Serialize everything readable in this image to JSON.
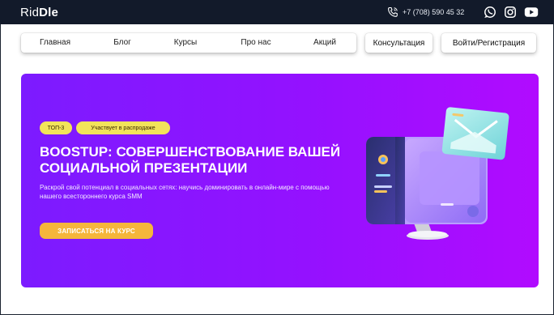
{
  "header": {
    "logo_light": "Rid",
    "logo_bold": "Dle",
    "phone": "+7 (708) 590 45 32",
    "icons": [
      "phone-icon",
      "whatsapp-icon",
      "instagram-icon",
      "youtube-icon"
    ]
  },
  "nav": {
    "items": [
      "Главная",
      "Блог",
      "Курсы",
      "Про нас",
      "Акций"
    ],
    "consult_label": "Консультация",
    "login_label": "Войти/Регистрация"
  },
  "hero": {
    "badge_top": "ТОП-3",
    "badge_sale": "Участвует в распродаже",
    "title": "BOOSTUP: СОВЕРШЕНСТВОВАНИЕ ВАШЕЙ СОЦИАЛЬНОЙ ПРЕЗЕНТАЦИИ",
    "description": "Раскрой свой потенциал в социальных сетях: научись доминировать в онлайн-мире с помощью нашего всестороннего курса SMM",
    "cta_label": "ЗАПИСАТЬСЯ НА КУРС",
    "illustration_icon": "computer-mail-illustration"
  },
  "colors": {
    "topbar": "#121a2a",
    "hero_start": "#7c1bff",
    "hero_end": "#b10bff",
    "badge": "#f2e35a",
    "cta": "#f5b63b"
  }
}
